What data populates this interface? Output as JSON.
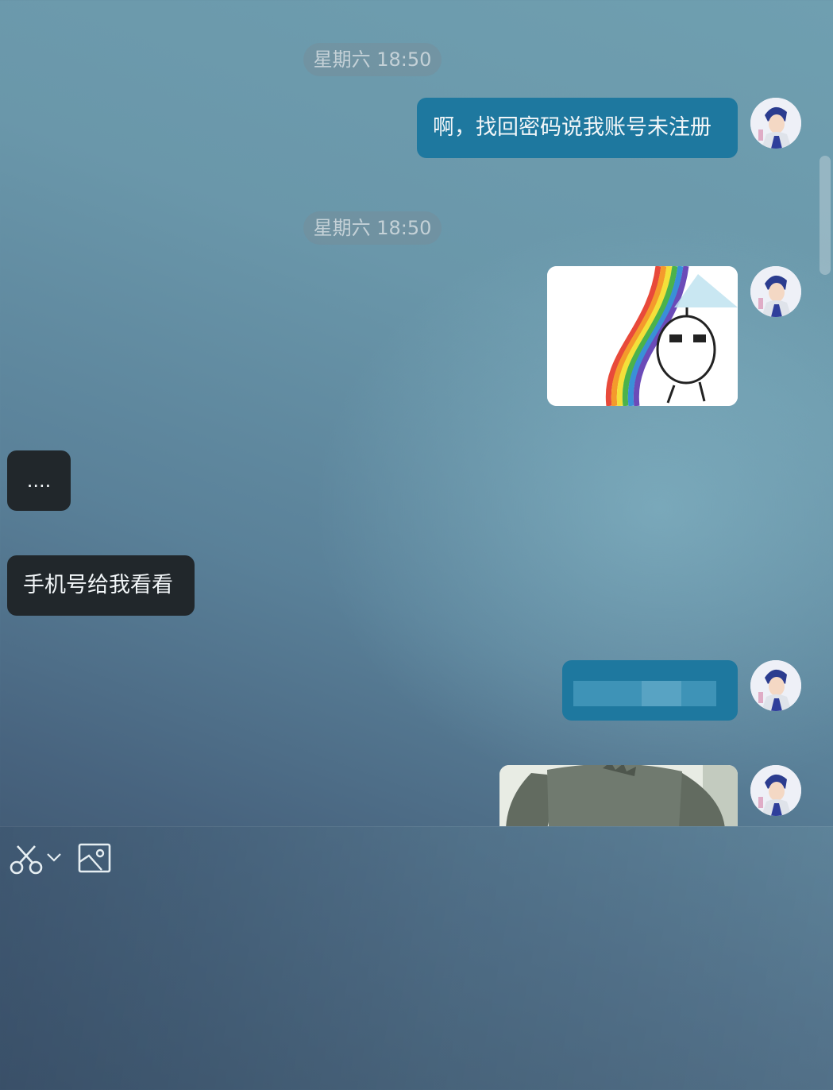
{
  "messages": {
    "timestamp_1": "星期六 18:50",
    "sent_text_1": "啊，找回密码说我账号未注册",
    "timestamp_2": "星期六 18:50",
    "received_text_1": "....",
    "received_text_2": "手机号给我看看"
  },
  "toolbar": {
    "icons": [
      "scissors-icon",
      "chevron-down-icon",
      "image-icon"
    ]
  },
  "colors": {
    "sent_bubble": "#1e789f",
    "received_bubble": "#21272b",
    "timestamp_pill": "#6f8a95"
  }
}
